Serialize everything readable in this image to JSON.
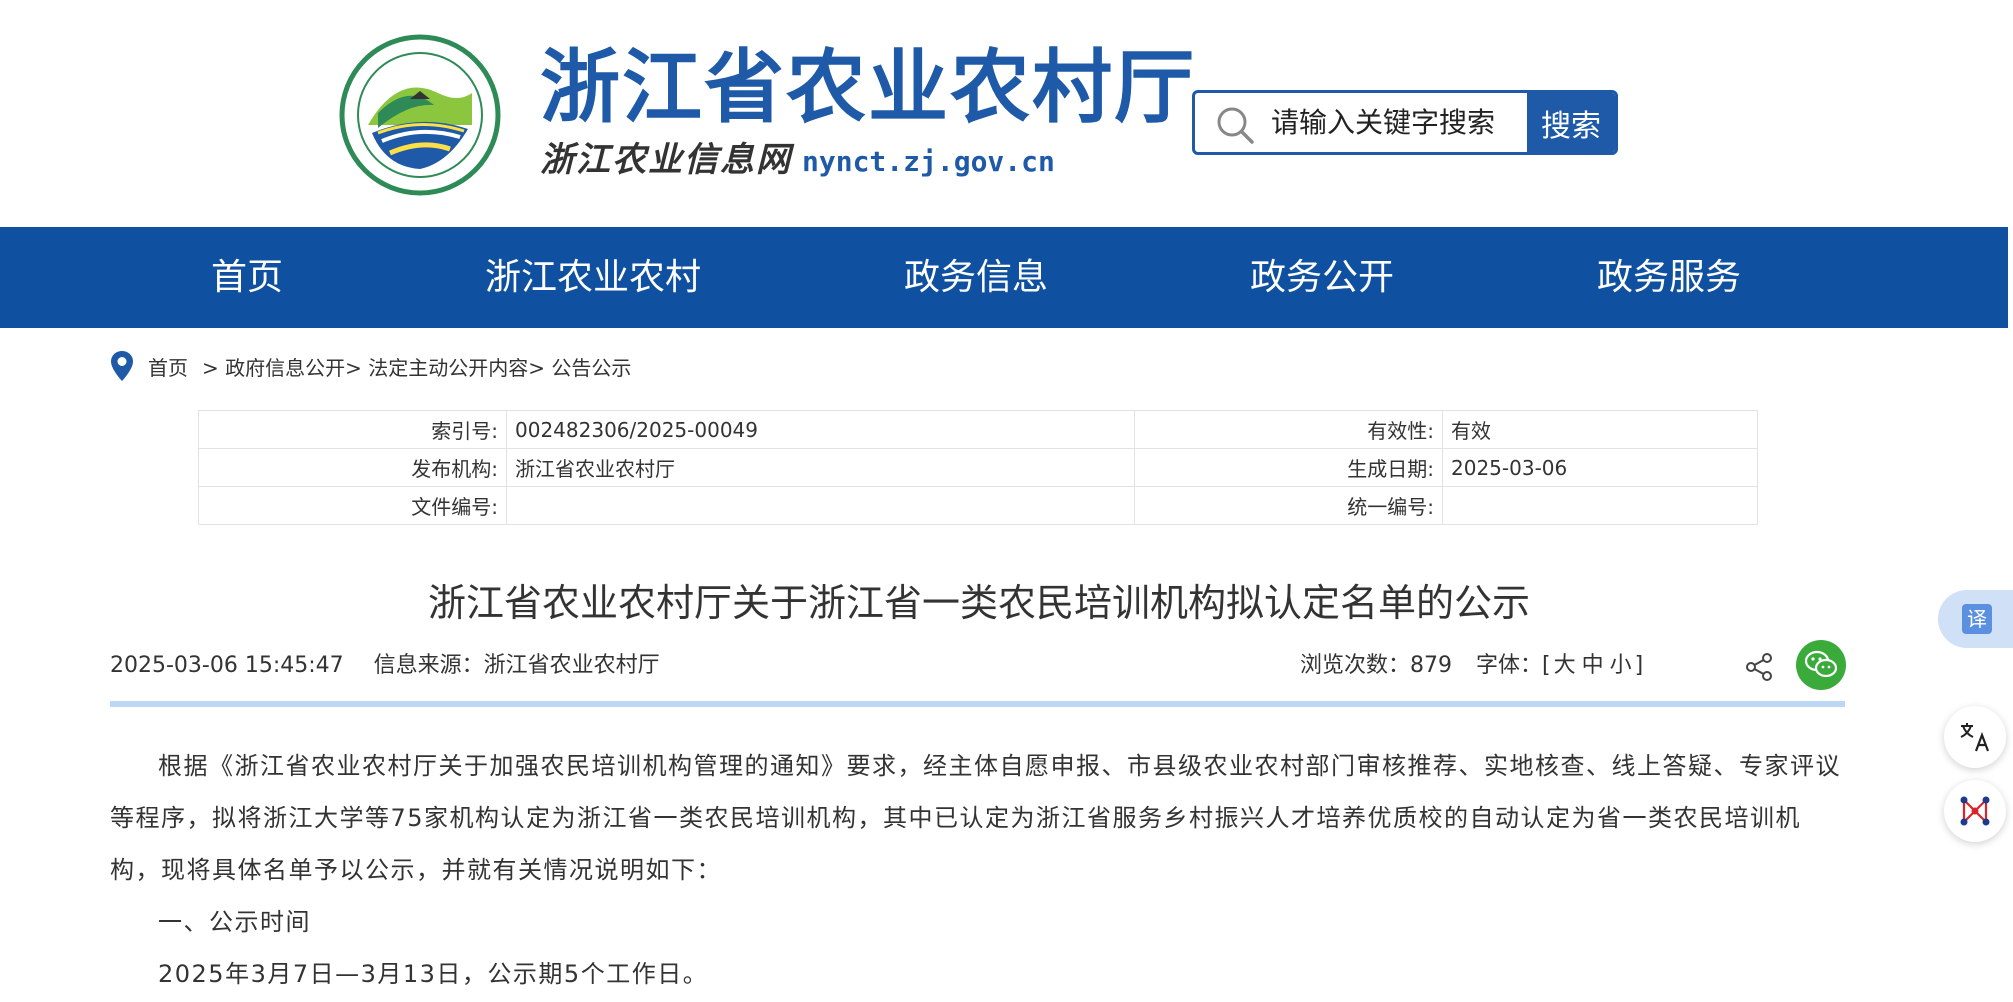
{
  "header": {
    "site_title": "浙江省农业农村厅",
    "site_subtitle": "浙江农业信息网",
    "site_url": "nynct.zj.gov.cn",
    "search_placeholder": "请输入关键字搜索",
    "search_button": "搜索"
  },
  "nav": {
    "items": [
      {
        "label": "首页"
      },
      {
        "label": "浙江农业农村"
      },
      {
        "label": "政务信息"
      },
      {
        "label": "政务公开"
      },
      {
        "label": "政务服务"
      }
    ]
  },
  "breadcrumb": {
    "home": "首页",
    "path": "> 政府信息公开> 法定主动公开内容> 公告公示"
  },
  "meta": {
    "index_label": "索引号:",
    "index_value": "002482306/2025-00049",
    "validity_label": "有效性:",
    "validity_value": "有效",
    "publisher_label": "发布机构:",
    "publisher_value": "浙江省农业农村厅",
    "date_label": "生成日期:",
    "date_value": "2025-03-06",
    "doc_no_label": "文件编号:",
    "doc_no_value": "",
    "unified_no_label": "统一编号:",
    "unified_no_value": ""
  },
  "article": {
    "title": "浙江省农业农村厅关于浙江省一类农民培训机构拟认定名单的公示",
    "datetime": "2025-03-06 15:45:47",
    "source": "信息来源：浙江省农业农村厅",
    "views": "浏览次数：879",
    "font_label": "字体：[",
    "font_large": "大",
    "font_medium": "中",
    "font_small": "小",
    "font_close": "]",
    "para1": "根据《浙江省农业农村厅关于加强农民培训机构管理的通知》要求，经主体自愿申报、市县级农业农村部门审核推荐、实地核查、线上答疑、专家评议等程序，拟将浙江大学等75家机构认定为浙江省一类农民培训机构，其中已认定为浙江省服务乡村振兴人才培养优质校的自动认定为省一类农民培训机构，现将具体名单予以公示，并就有关情况说明如下：",
    "section1": "一、公示时间",
    "para2": "2025年3月7日—3月13日，公示期5个工作日。"
  },
  "tools": {
    "translate_glyph": "译"
  },
  "colors": {
    "brand_blue": "#1e5aa8",
    "nav_blue": "#0f50a0",
    "divider_blue": "#bcd7f5",
    "wechat_green": "#3aab3a"
  }
}
